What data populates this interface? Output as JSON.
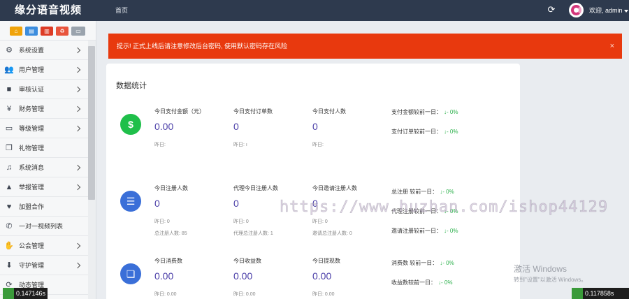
{
  "topbar": {
    "brand": "缘分语音视频",
    "nav_home": "首页",
    "user": "欢迎, admin",
    "icons": [
      "refresh-icon",
      "avatar",
      "caret-down-icon"
    ]
  },
  "sidebar": {
    "shortcuts": [
      {
        "icon": "home-icon",
        "color": "#f0a30a"
      },
      {
        "icon": "file-icon",
        "color": "#3c8dde"
      },
      {
        "icon": "trash-icon",
        "color": "#dd3b25"
      },
      {
        "icon": "recycle-icon",
        "color": "#e8543c"
      },
      {
        "icon": "window-icon",
        "color": "#9aa3ad"
      }
    ],
    "items": [
      {
        "label": "系统设置",
        "icon": "gears-icon",
        "arrow": true
      },
      {
        "label": "用户管理",
        "icon": "users-icon",
        "arrow": true
      },
      {
        "label": "审核认证",
        "icon": "video-icon",
        "arrow": true
      },
      {
        "label": "财务管理",
        "icon": "yen-icon",
        "arrow": true
      },
      {
        "label": "等级管理",
        "icon": "monitor-icon",
        "arrow": true
      },
      {
        "label": "礼物管理",
        "icon": "gift-icon",
        "arrow": false
      },
      {
        "label": "系统消息",
        "icon": "bell-icon",
        "arrow": true
      },
      {
        "label": "举报管理",
        "icon": "warning-icon",
        "arrow": true
      },
      {
        "label": "加盟合作",
        "icon": "heart-icon",
        "arrow": false
      },
      {
        "label": "一对一视频列表",
        "icon": "phone-icon",
        "arrow": false
      },
      {
        "label": "公会管理",
        "icon": "handshake-icon",
        "arrow": true
      },
      {
        "label": "守护管理",
        "icon": "download-icon",
        "arrow": true
      },
      {
        "label": "动态管理",
        "icon": "refresh-icon",
        "arrow": false
      }
    ]
  },
  "alert": {
    "text": "提示! 正式上线后请注意修改后台密码, 使用默认密码存在风险",
    "close": "×",
    "color": "#e8390e"
  },
  "panel": {
    "title": "数据统计",
    "rows": [
      {
        "icon": "money-icon",
        "color": "#1fbf4a",
        "stats": [
          {
            "label": "今日支付金额（元）",
            "value": "0.00",
            "sub": "昨日:"
          },
          {
            "label": "今日支付订单数",
            "value": "0",
            "sub": "昨日: ı"
          },
          {
            "label": "今日支付人数",
            "value": "0",
            "sub": "昨日:"
          }
        ],
        "extra": [
          "",
          "",
          ""
        ],
        "compare": [
          {
            "label": "支付金额较前一日：",
            "arrow": "↓",
            "value": "- 0%"
          },
          {
            "label": "支付订单较前一日：",
            "arrow": "↓",
            "value": "- 0%"
          }
        ]
      },
      {
        "icon": "clipboard-icon",
        "color": "#3a6fd8",
        "stats": [
          {
            "label": "今日注册人数",
            "value": "0",
            "sub": "昨日: 0"
          },
          {
            "label": "代理今日注册人数",
            "value": "0",
            "sub": "昨日: 0"
          },
          {
            "label": "今日邀请注册人数",
            "value": "0",
            "sub": "昨日: 0"
          }
        ],
        "extra": [
          "总注册人数: 85",
          "代理总注册人数: 1",
          "邀请总注册人数: 0"
        ],
        "compare": [
          {
            "label": "总注册 较前一日：",
            "arrow": "↓",
            "value": "- 0%"
          },
          {
            "label": "代理注册较前一日：",
            "arrow": "↓",
            "value": "- 0%"
          },
          {
            "label": "邀请注册较前一日：",
            "arrow": "↓",
            "value": "- 0%"
          }
        ]
      },
      {
        "icon": "copy-icon",
        "color": "#3a6fd8",
        "stats": [
          {
            "label": "今日消费数",
            "value": "0.00",
            "sub": "昨日: 0.00"
          },
          {
            "label": "今日收益数",
            "value": "0.00",
            "sub": "昨日: 0.00"
          },
          {
            "label": "今日提现数",
            "value": "0.00",
            "sub": "昨日: 0.00"
          }
        ],
        "extra": [
          "",
          "",
          ""
        ],
        "compare": [
          {
            "label": "消费数 较前一日：",
            "arrow": "↓",
            "value": "- 0%"
          },
          {
            "label": "收益数较前一日：",
            "arrow": "↓",
            "value": "- 0%"
          }
        ]
      }
    ]
  },
  "overlay": {
    "watermark": "https://www.huzhan.com/ishop44129",
    "activate_title": "激活 Windows",
    "activate_sub": "转到\"设置\"以激活 Windows。",
    "timer_left": "0.147146s",
    "timer_right": "0.117858s"
  }
}
